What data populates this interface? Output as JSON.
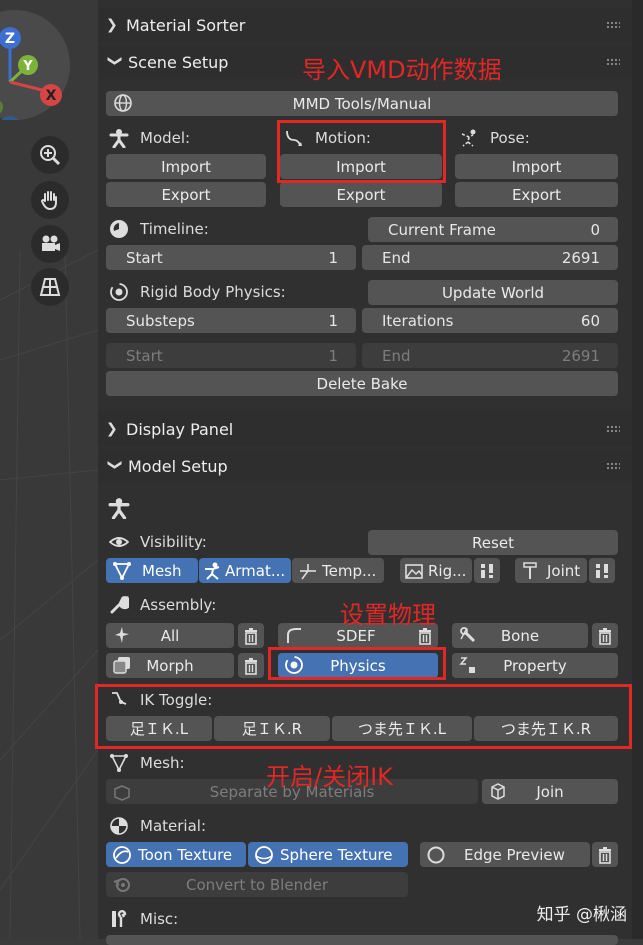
{
  "sections": {
    "material_sorter": "Material Sorter",
    "scene_setup": "Scene Setup",
    "display_panel": "Display Panel",
    "model_setup": "Model Setup"
  },
  "scene": {
    "manual_button": "MMD Tools/Manual",
    "model_label": "Model:",
    "motion_label": "Motion:",
    "pose_label": "Pose:",
    "import": "Import",
    "export": "Export",
    "timeline_label": "Timeline:",
    "current_frame_label": "Current Frame",
    "current_frame_value": "0",
    "start_label": "Start",
    "start_value": "1",
    "end_label": "End",
    "end_value": "2691",
    "rigid_label": "Rigid Body Physics:",
    "update_world": "Update World",
    "substeps_label": "Substeps",
    "substeps_value": "1",
    "iterations_label": "Iterations",
    "iterations_value": "60",
    "bake_start_label": "Start",
    "bake_start_value": "1",
    "bake_end_label": "End",
    "bake_end_value": "2691",
    "delete_bake": "Delete Bake"
  },
  "model": {
    "visibility_label": "Visibility:",
    "reset": "Reset",
    "mesh_toggle": "Mesh",
    "armature_toggle": "Armat...",
    "temp_toggle": "Temp...",
    "rigid_toggle": "Rig...",
    "joint_toggle": "Joint",
    "assembly_label": "Assembly:",
    "all": "All",
    "sdef": "SDEF",
    "bone": "Bone",
    "morph": "Morph",
    "physics": "Physics",
    "property": "Property",
    "ik_label": "IK Toggle:",
    "ik_buttons": [
      "足ＩＫ.L",
      "足ＩＫ.R",
      "つま先ＩＫ.L",
      "つま先ＩＫ.R"
    ],
    "mesh_label": "Mesh:",
    "separate": "Separate by Materials",
    "join": "Join",
    "material_label": "Material:",
    "toon_texture": "Toon Texture",
    "sphere_texture": "Sphere Texture",
    "edge_preview": "Edge Preview",
    "convert": "Convert to Blender",
    "misc_label": "Misc:"
  },
  "annotations": {
    "import_vmd": "导入VMD动作数据",
    "set_physics": "设置物理",
    "toggle_ik": "开启/关闭IK"
  },
  "watermark": "知乎 @楸涵",
  "colors": {
    "annotation_red": "#e32626",
    "selected_blue": "#4472b3",
    "button_gray": "#545454"
  }
}
